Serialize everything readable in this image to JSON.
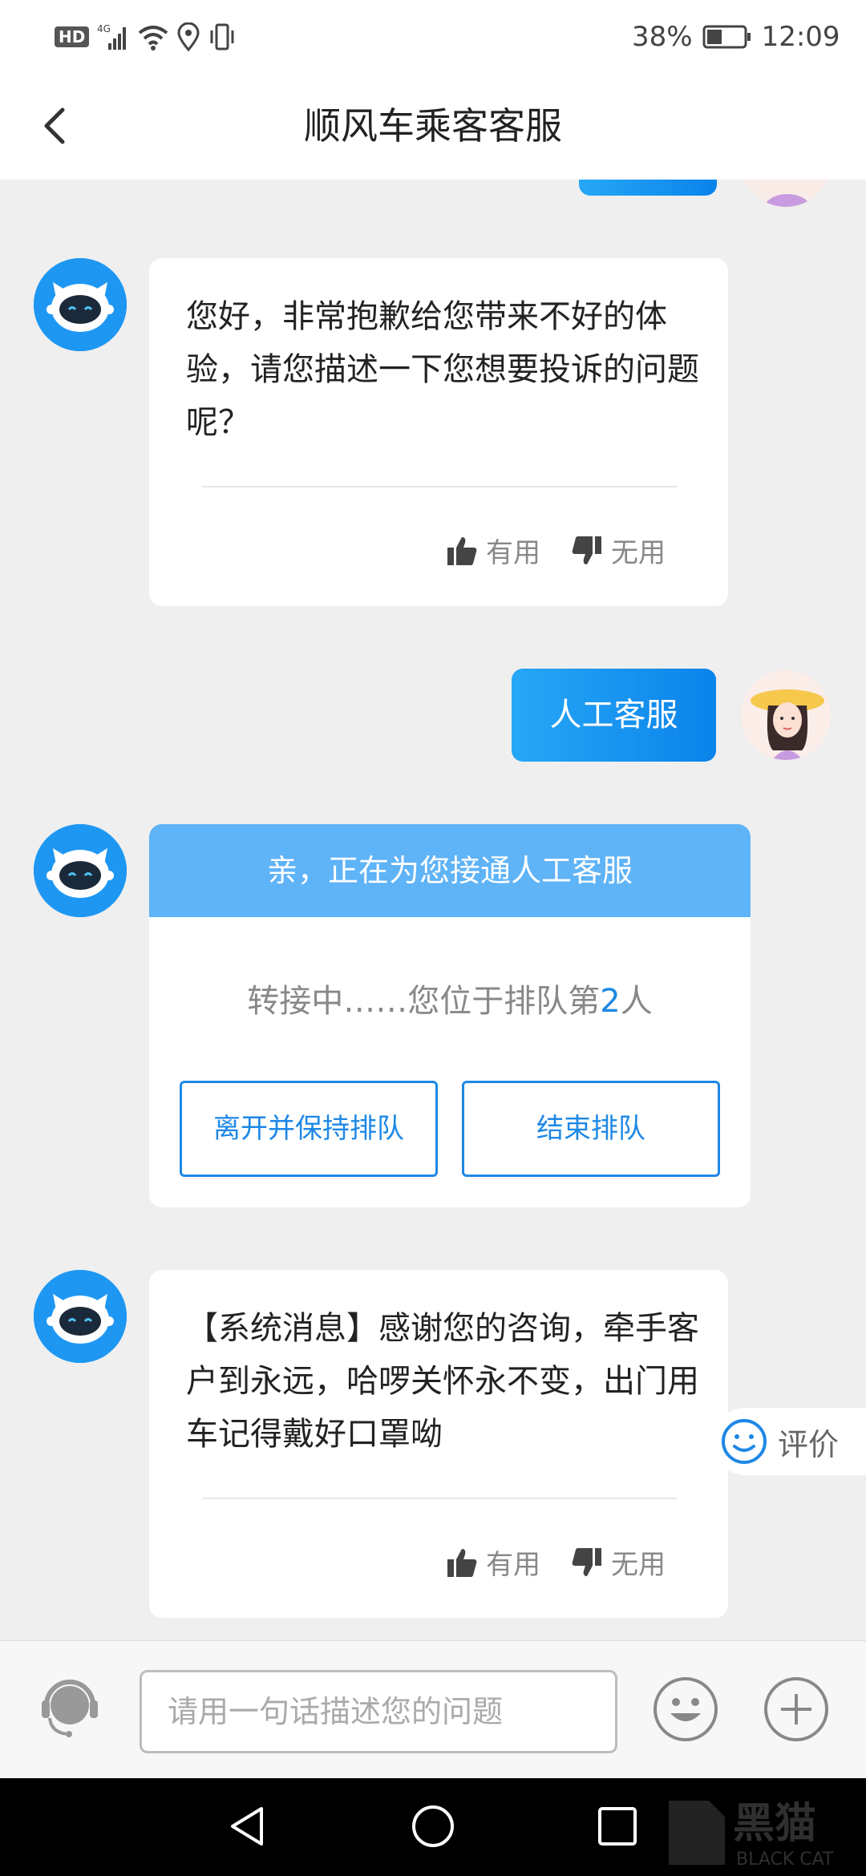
{
  "status_bar": {
    "network_badge": "HD",
    "battery_percent": "38%",
    "time": "12:09",
    "icons": [
      "hd-icon",
      "signal-4g-icon",
      "wifi-icon",
      "location-icon",
      "vibrate-icon",
      "battery-icon"
    ]
  },
  "header": {
    "title": "顺风车乘客客服",
    "back_icon": "chevron-left-icon"
  },
  "messages": [
    {
      "sender": "bot",
      "text": "您好，非常抱歉给您带来不好的体验，请您描述一下您想要投诉的问题呢？",
      "useful_label": "有用",
      "useless_label": "无用"
    },
    {
      "sender": "user",
      "text": "人工客服"
    },
    {
      "sender": "bot",
      "type": "queue_card",
      "header": "亲，正在为您接通人工客服",
      "status_prefix": "转接中……您位于排队第",
      "queue_number": "2",
      "status_suffix": "人",
      "leave_button": "离开并保持排队",
      "end_button": "结束排队"
    },
    {
      "sender": "bot",
      "text": "【系统消息】感谢您的咨询，牵手客户到永远，哈啰关怀永不变，出门用车记得戴好口罩呦",
      "useful_label": "有用",
      "useless_label": "无用"
    }
  ],
  "rating": {
    "label": "评价",
    "icon": "smiley-icon"
  },
  "input_bar": {
    "placeholder": "请用一句话描述您的问题",
    "agent_icon": "headset-agent-icon",
    "emoji_icon": "emoji-icon",
    "plus_icon": "plus-circle-icon"
  },
  "nav_bar": {
    "icons": [
      "back-triangle-icon",
      "home-circle-icon",
      "recents-square-icon"
    ]
  },
  "watermark": "黑猫 BLACK CAT",
  "colors": {
    "accent": "#1e88e5",
    "user_bubble": "#1d95f0",
    "queue_header": "#5fb3f7",
    "background": "#efefef"
  }
}
